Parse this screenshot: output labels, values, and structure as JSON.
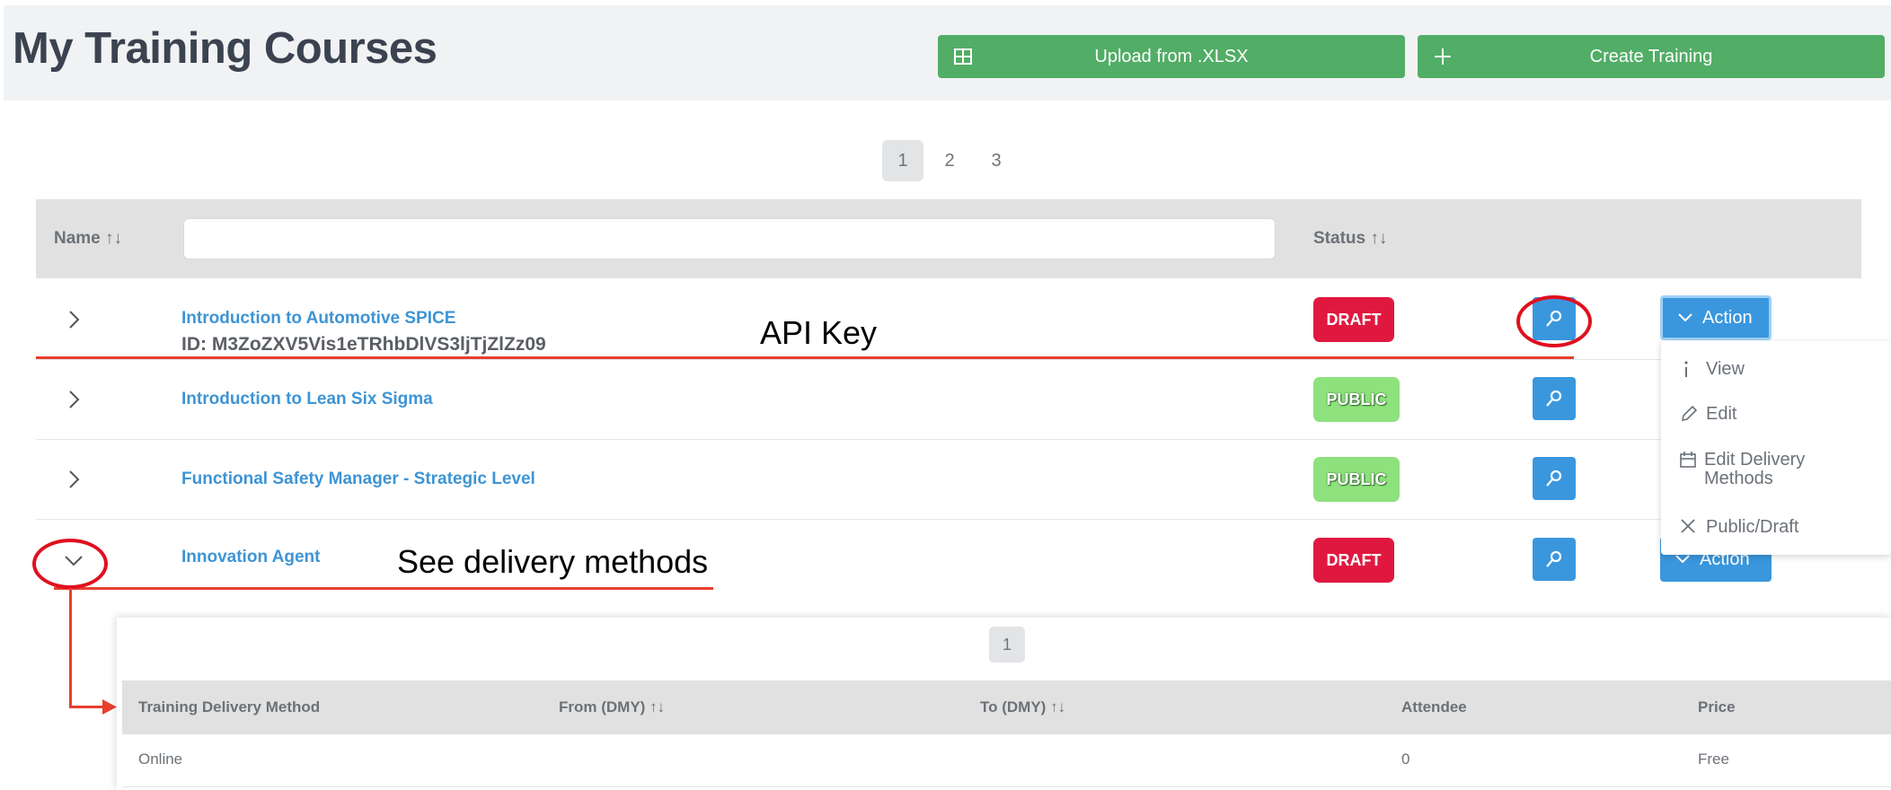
{
  "header": {
    "title": "My Training Courses",
    "upload_label": "Upload from .XLSX",
    "upload_icon": "table-icon",
    "create_label": "Create Training",
    "create_icon": "plus-icon"
  },
  "pagination": {
    "pages": [
      "1",
      "2",
      "3"
    ],
    "active": "1"
  },
  "table": {
    "col_name": "Name",
    "col_status": "Status",
    "sort_glyph": "↑↓",
    "search_value": "",
    "rows": [
      {
        "name": "Introduction to Automotive SPICE",
        "id": "ID: M3ZoZXV5Vis1eTRhbDlVS3ljTjZlZz09",
        "status": "DRAFT",
        "expanded": false
      },
      {
        "name": "Introduction to Lean Six Sigma",
        "status": "PUBLIC",
        "expanded": false
      },
      {
        "name": "Functional Safety Manager - Strategic Level",
        "status": "PUBLIC",
        "expanded": false
      },
      {
        "name": "Innovation Agent",
        "status": "DRAFT",
        "expanded": true
      }
    ]
  },
  "action_button": {
    "label": "Action"
  },
  "action_menu": {
    "items": [
      {
        "label": "View",
        "icon": "info-icon"
      },
      {
        "label": "Edit",
        "icon": "pencil-icon"
      },
      {
        "label": "Edit Delivery Methods",
        "icon": "calendar-icon"
      },
      {
        "label": "Public/Draft",
        "icon": "close-icon"
      }
    ]
  },
  "annotations": {
    "api_key": "API Key",
    "delivery": "See delivery methods"
  },
  "delivery_table": {
    "pagination": "1",
    "headers": {
      "method": "Training Delivery Method",
      "from": "From (DMY)",
      "to": "To (DMY)",
      "attendee": "Attendee",
      "price": "Price"
    },
    "rows": [
      {
        "method": "Online",
        "from": "",
        "to": "",
        "attendee": "0",
        "price": "Free"
      }
    ]
  },
  "colors": {
    "green_button": "#52ad66",
    "link_blue": "#3e94d4",
    "draft_red": "#e0183f",
    "public_green": "#8ee27d",
    "action_blue": "#3a97dd",
    "annotation_red": "#e0101f"
  }
}
